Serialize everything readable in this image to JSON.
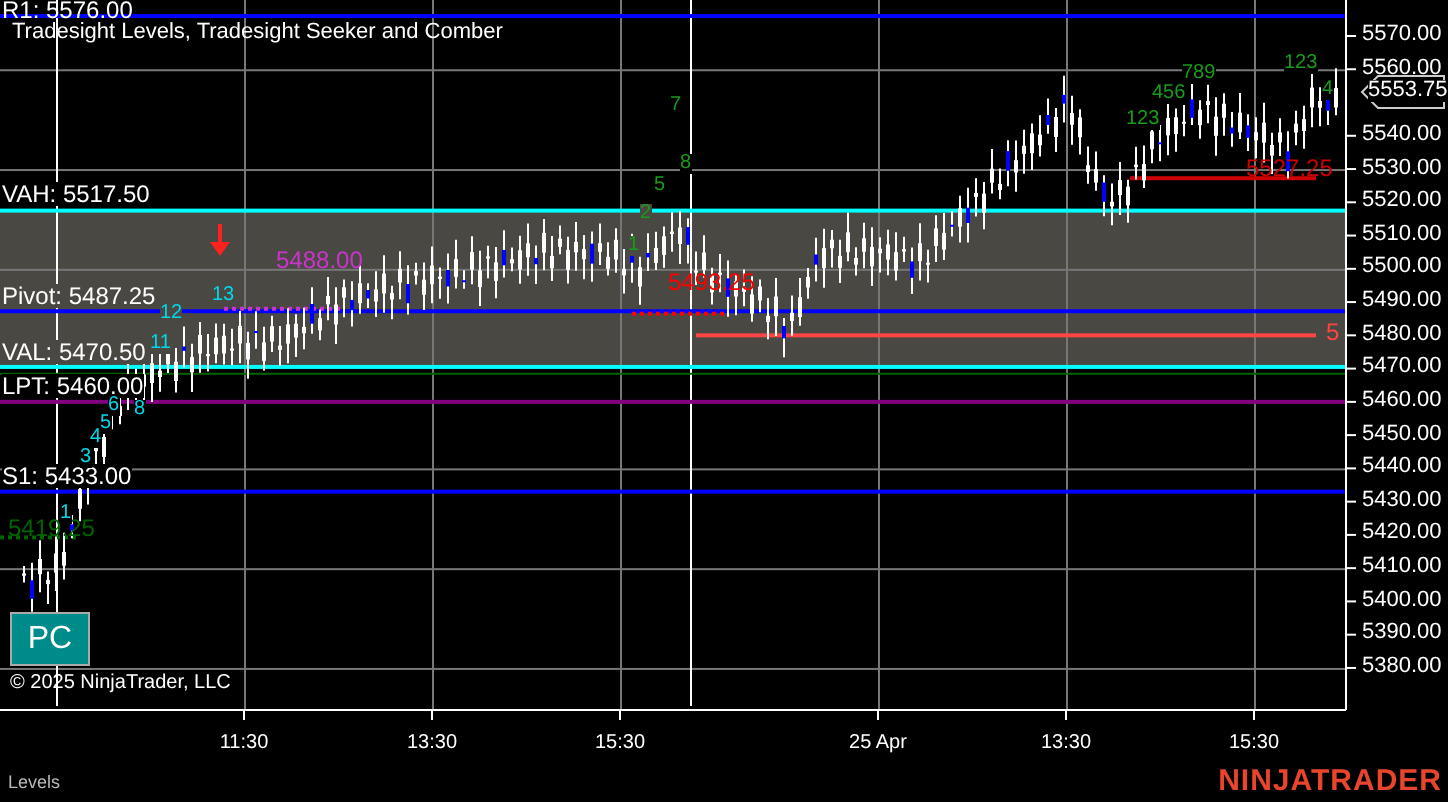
{
  "chart": {
    "title": "Tradesight Levels, Tradesight Seeker and Comber",
    "copyright": "© 2025 NinjaTrader, LLC",
    "panel_label": "Levels",
    "logo": "NINJATRADER"
  },
  "levels": [
    {
      "label": "R1: 5576.00",
      "color": "#0000ff"
    },
    {
      "label": "VAH: 5517.50",
      "color": "#00ffff"
    },
    {
      "label": "Pivot: 5487.25",
      "color": "#0000ff"
    },
    {
      "label": "VAL: 5470.50",
      "color": "#00ffff"
    },
    {
      "label": "LPT: 5460.00",
      "color": "#800080"
    },
    {
      "label": "S1: 5433.00",
      "color": "#0000ff"
    }
  ],
  "markers": [
    {
      "kind": "dotted",
      "label": "5488.00",
      "color": "#cc33cc"
    },
    {
      "kind": "dotted",
      "label": "5493.25",
      "color": "#ff0000"
    },
    {
      "kind": "dotted",
      "label": "5419.25",
      "color": "#006400"
    },
    {
      "kind": "solid",
      "label": "5527.25",
      "color": "#cc0000"
    },
    {
      "kind": "solid",
      "label": "5",
      "color": "#ff4444"
    }
  ],
  "counts": [
    {
      "text": "1",
      "kind": "seeker"
    },
    {
      "text": "3",
      "kind": "seeker"
    },
    {
      "text": "4",
      "kind": "seeker"
    },
    {
      "text": "5",
      "kind": "seeker"
    },
    {
      "text": "6",
      "kind": "seeker"
    },
    {
      "text": "8",
      "kind": "seeker"
    },
    {
      "text": "11",
      "kind": "seeker"
    },
    {
      "text": "12",
      "kind": "seeker"
    },
    {
      "text": "13",
      "kind": "seeker"
    },
    {
      "text": "7",
      "kind": "comber"
    },
    {
      "text": "8",
      "kind": "comber"
    },
    {
      "text": "5",
      "kind": "comber"
    },
    {
      "text": "2",
      "kind": "comber"
    },
    {
      "text": "1",
      "kind": "comber"
    },
    {
      "text": "123",
      "kind": "comber"
    },
    {
      "text": "456",
      "kind": "comber"
    },
    {
      "text": "789",
      "kind": "comber"
    },
    {
      "text": "123",
      "kind": "comber"
    },
    {
      "text": "4",
      "kind": "comber"
    }
  ],
  "pc_button": "PC",
  "price_axis": {
    "ticks": [
      "5570.00",
      "5560.00",
      "5540.00",
      "5530.00",
      "5520.00",
      "5510.00",
      "5500.00",
      "5490.00",
      "5480.00",
      "5470.00",
      "5460.00",
      "5450.00",
      "5440.00",
      "5430.00",
      "5420.00",
      "5410.00",
      "5400.00",
      "5390.00",
      "5380.00"
    ],
    "current_price": "5553.75"
  },
  "time_axis": [
    "11:30",
    "13:30",
    "15:30",
    "25 Apr",
    "13:30",
    "15:30"
  ]
}
